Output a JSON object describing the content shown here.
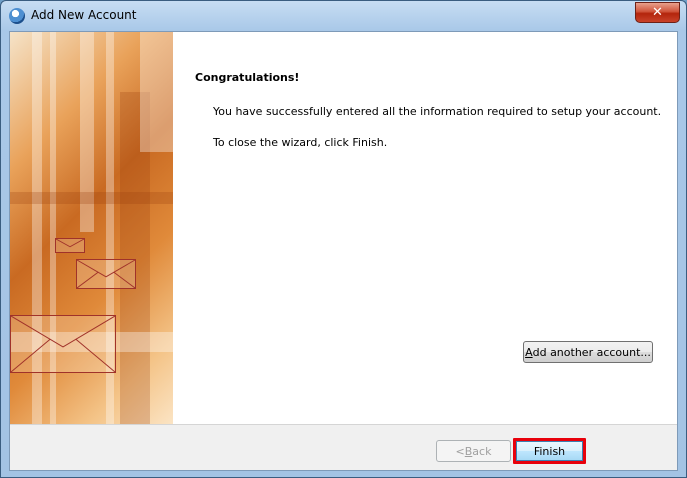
{
  "window": {
    "title": "Add New Account",
    "close_symbol": "✕"
  },
  "main": {
    "heading": "Congratulations!",
    "message_success": "You have successfully entered all the information required to setup your account.",
    "message_close": "To close the wizard, click Finish."
  },
  "buttons": {
    "add_another_prefix": "",
    "add_another_mnemonic": "A",
    "add_another_rest": "dd another account...",
    "back_prefix": "< ",
    "back_mnemonic": "B",
    "back_rest": "ack",
    "finish_label": "Finish"
  },
  "icons": {
    "title_icon": "outlook-icon",
    "close_icon": "close-icon"
  },
  "colors": {
    "finish_highlight": "#e8000b"
  }
}
